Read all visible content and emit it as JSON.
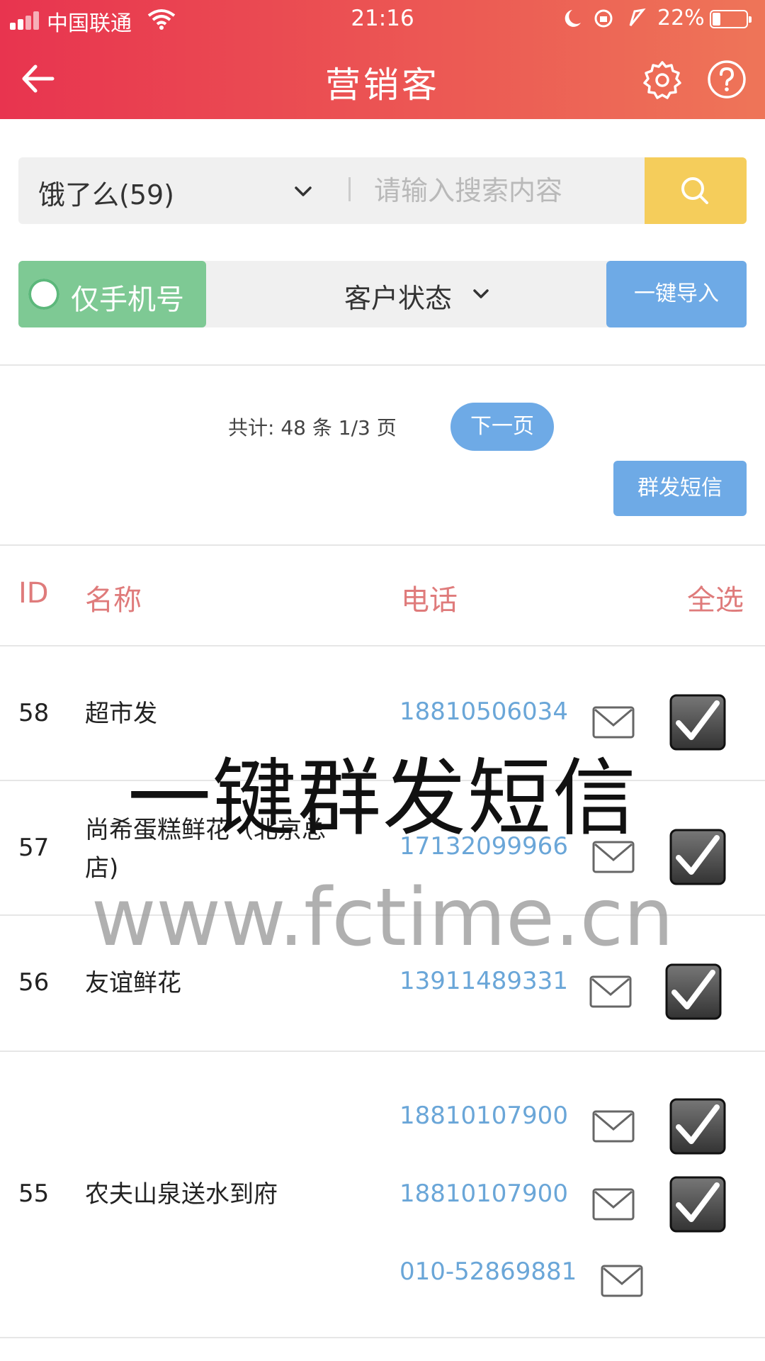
{
  "status_bar": {
    "carrier": "中国联通",
    "time": "21:16",
    "battery": "22%"
  },
  "header": {
    "title": "营销客"
  },
  "search": {
    "selected_source": "饿了么(59)",
    "placeholder": "请输入搜索内容"
  },
  "filter": {
    "toggle_label": "仅手机号",
    "status_label": "客户状态",
    "import_label": "一键导入"
  },
  "pagination": {
    "total_text": "共计: 48 条 1/3 页",
    "next_label": "下一页"
  },
  "mass_sms_label": "群发短信",
  "table": {
    "headers": {
      "id": "ID",
      "name": "名称",
      "phone": "电话",
      "select_all": "全选"
    },
    "rows": [
      {
        "id": "58",
        "name": "超市发",
        "phones": [
          "18810506034"
        ]
      },
      {
        "id": "57",
        "name": "尚希蛋糕鲜花（北京总店)",
        "phones": [
          "17132099966"
        ]
      },
      {
        "id": "56",
        "name": "友谊鲜花",
        "phones": [
          "13911489331"
        ]
      },
      {
        "id": "55",
        "name": "农夫山泉送水到府",
        "phones": [
          "18810107900",
          "18810107900",
          "010-52869881"
        ]
      }
    ]
  },
  "overlay": {
    "caption": "一键群发短信",
    "url": "www.fctime.cn"
  },
  "icons": [
    "back-arrow-icon",
    "gear-icon",
    "help-icon",
    "chevron-down-icon",
    "search-icon",
    "mail-icon",
    "checkbox-checked-icon"
  ],
  "colors": {
    "header_start": "#e8344f",
    "header_end": "#ee7558",
    "search_button": "#f5cd5b",
    "toggle_green": "#7ec994",
    "button_blue": "#6eaae6",
    "header_text_red": "#df7b7b",
    "phone_blue": "#6aa6d8"
  }
}
